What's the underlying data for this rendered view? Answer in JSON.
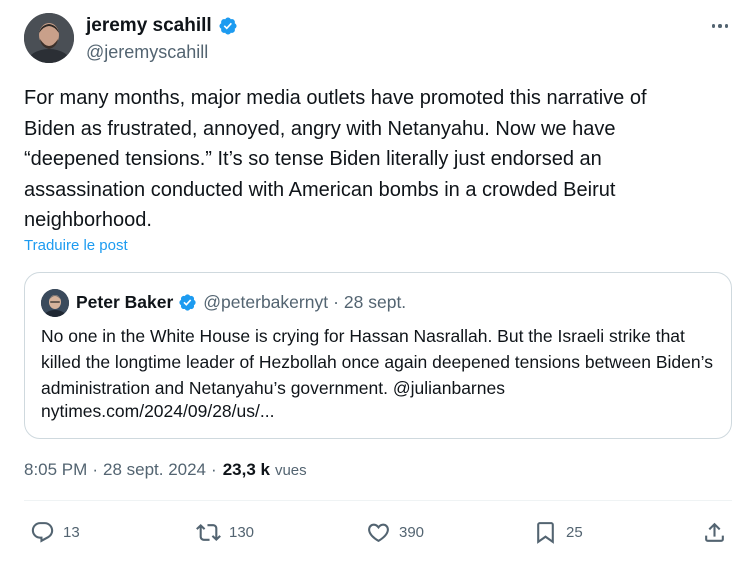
{
  "author": {
    "name": "jeremy scahill",
    "handle": "@jeremyscahill",
    "verified_color": "#1d9bf0"
  },
  "tweet": {
    "text": "For many months, major media outlets have promoted this narrative of\nBiden as frustrated, annoyed, angry with Netanyahu. Now we have\n“deepened tensions.” It’s so tense Biden literally just endorsed an\nassassination conducted with American bombs in a crowded Beirut\nneighborhood.",
    "translate_label": "Traduire le post"
  },
  "quote": {
    "name": "Peter Baker",
    "handle": "@peterbakernyt",
    "separator": "·",
    "date": "28 sept.",
    "text": "No one in the White House is crying for Hassan Nasrallah. But the Israeli strike that killed the longtime leader of Hezbollah once again deepened tensions between Biden’s administration and Netanyahu’s government. @julianbarnes",
    "link": "nytimes.com/2024/09/28/us/..."
  },
  "meta": {
    "time": "8:05 PM",
    "date": "28 sept. 2024",
    "separator": "·",
    "views_count": "23,3 k",
    "views_label": "vues"
  },
  "actions": {
    "replies": "13",
    "reposts": "130",
    "likes": "390",
    "bookmarks": "25"
  },
  "icons": {
    "more": "more-dots-icon",
    "reply": "reply-bubble-icon",
    "repost": "repost-arrows-icon",
    "like": "heart-icon",
    "bookmark": "bookmark-icon",
    "share": "share-upload-icon"
  }
}
